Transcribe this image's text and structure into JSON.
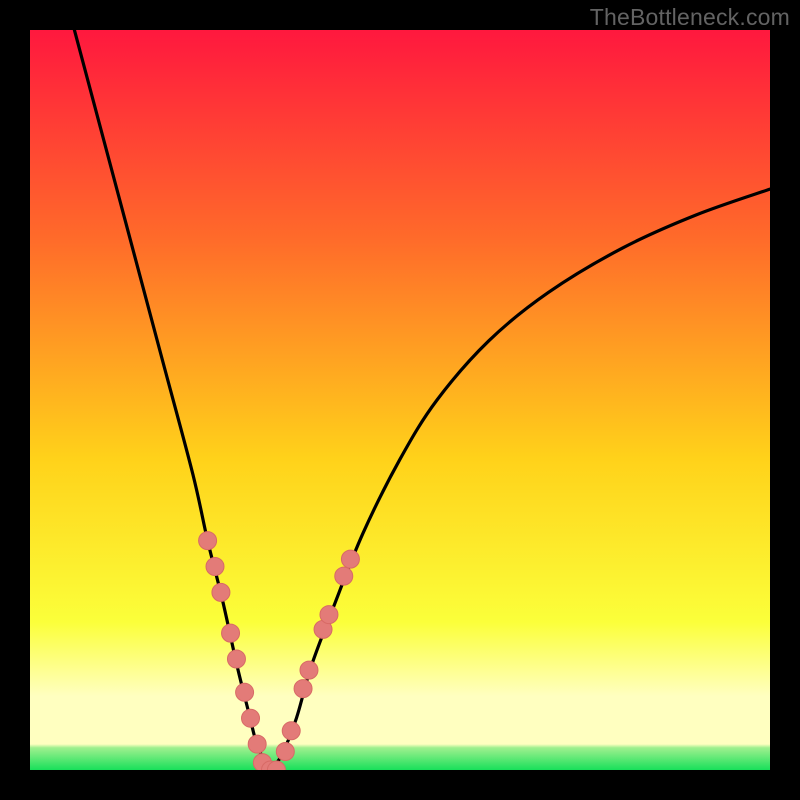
{
  "watermark": "TheBottleneck.com",
  "colors": {
    "frame": "#000000",
    "watermark": "#636363",
    "gradient_top": "#ff183e",
    "gradient_mid_upper": "#ff6a2a",
    "gradient_mid": "#ffd21a",
    "gradient_lower": "#fbff3a",
    "gradient_pale": "#ffffc0",
    "gradient_bottom": "#18e05a",
    "curve": "#000000",
    "marker_fill": "#e37b78",
    "marker_stroke": "#d86a66"
  },
  "chart_data": {
    "type": "line",
    "title": "",
    "xlabel": "",
    "ylabel": "",
    "xlim": [
      0,
      100
    ],
    "ylim": [
      0,
      100
    ],
    "legend": false,
    "grid": false,
    "series": [
      {
        "name": "left-branch",
        "x": [
          6,
          10,
          14,
          18,
          22,
          24,
          26,
          28,
          29.5,
          30.5,
          31.5,
          32.5
        ],
        "values": [
          100,
          85,
          70,
          55,
          40,
          31,
          23,
          14,
          8,
          4,
          1.5,
          0
        ]
      },
      {
        "name": "right-branch",
        "x": [
          32.5,
          34,
          36,
          38,
          41,
          45,
          50,
          55,
          62,
          70,
          80,
          90,
          100
        ],
        "values": [
          0,
          2,
          7,
          14,
          22,
          32,
          42,
          50,
          58,
          64.5,
          70.5,
          75,
          78.5
        ]
      }
    ],
    "markers": {
      "name": "highlighted-points",
      "points": [
        {
          "x": 24.0,
          "y": 31.0
        },
        {
          "x": 25.0,
          "y": 27.5
        },
        {
          "x": 25.8,
          "y": 24.0
        },
        {
          "x": 27.1,
          "y": 18.5
        },
        {
          "x": 27.9,
          "y": 15.0
        },
        {
          "x": 29.0,
          "y": 10.5
        },
        {
          "x": 29.8,
          "y": 7.0
        },
        {
          "x": 30.7,
          "y": 3.5
        },
        {
          "x": 31.4,
          "y": 1.0
        },
        {
          "x": 32.5,
          "y": 0.0
        },
        {
          "x": 33.3,
          "y": 0.0
        },
        {
          "x": 34.5,
          "y": 2.5
        },
        {
          "x": 35.3,
          "y": 5.3
        },
        {
          "x": 36.9,
          "y": 11.0
        },
        {
          "x": 37.7,
          "y": 13.5
        },
        {
          "x": 39.6,
          "y": 19.0
        },
        {
          "x": 40.4,
          "y": 21.0
        },
        {
          "x": 42.4,
          "y": 26.2
        },
        {
          "x": 43.3,
          "y": 28.5
        }
      ]
    },
    "gradient_bands": [
      {
        "from": 100,
        "to": 12,
        "kind": "smooth",
        "top_color": "#ff183e",
        "bottom_color": "#ffffc0"
      },
      {
        "from": 12,
        "to": 3,
        "kind": "pale-yellow"
      },
      {
        "from": 3,
        "to": 0,
        "kind": "green-band"
      }
    ]
  }
}
